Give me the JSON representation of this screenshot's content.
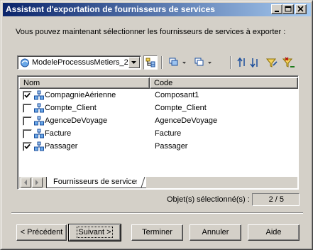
{
  "window": {
    "title": "Assistant d'exportation de fournisseurs de services"
  },
  "instruction": "Vous pouvez maintenant sélectionner les fournisseurs de services à exporter :",
  "model_select": {
    "value": "ModeleProcessusMetiers_2",
    "icon": "model-icon"
  },
  "toolbar": {
    "icons": [
      "hierarchy-icon",
      "select-all-icon",
      "deselect-all-icon",
      "move-up-icon",
      "move-down-icon",
      "filter-icon",
      "clear-filter-icon"
    ]
  },
  "list": {
    "columns": [
      "Nom",
      "Code"
    ],
    "rows": [
      {
        "name": "CompagnieAérienne",
        "code": "Composant1",
        "checked": true
      },
      {
        "name": "Compte_Client",
        "code": "Compte_Client",
        "checked": false
      },
      {
        "name": "AgenceDeVoyage",
        "code": "AgenceDeVoyage",
        "checked": false
      },
      {
        "name": "Facture",
        "code": "Facture",
        "checked": false
      },
      {
        "name": "Passager",
        "code": "Passager",
        "checked": true
      }
    ],
    "tab_label": "Fournisseurs de services"
  },
  "selection": {
    "label": "Objet(s) sélectionné(s) :",
    "value": "2 / 5"
  },
  "buttons": {
    "previous": "< Précédent",
    "next": "Suivant >",
    "finish": "Terminer",
    "cancel": "Annuler",
    "help": "Aide"
  }
}
